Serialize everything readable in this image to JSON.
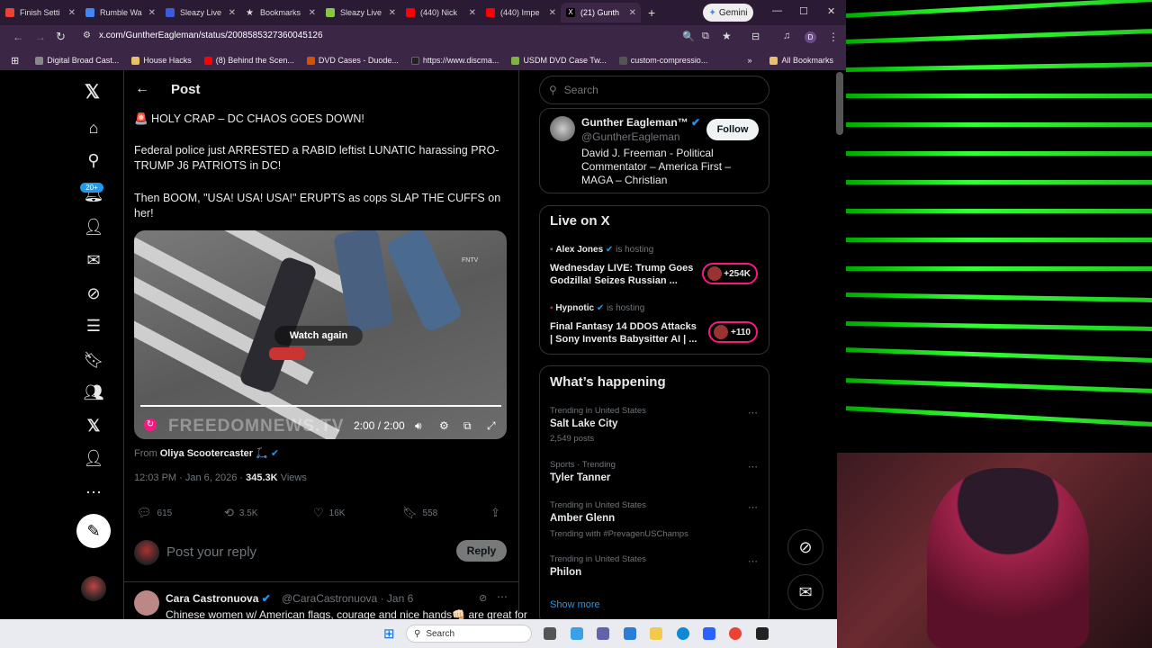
{
  "browser": {
    "tabs": [
      {
        "label": "Finish Setti",
        "color": "#ea4335"
      },
      {
        "label": "Rumble Wa",
        "color": "#4285f4"
      },
      {
        "label": "Sleazy Live",
        "color": "#3b5bdb"
      },
      {
        "label": "Bookmarks",
        "color": "#cccccc"
      },
      {
        "label": "Sleazy Live",
        "color": "#85c742"
      },
      {
        "label": "(440) Nick",
        "color": "#ff0000"
      },
      {
        "label": "(440) Impe",
        "color": "#ff0000"
      },
      {
        "label": "(21) Gunth",
        "color": "#ffffff"
      }
    ],
    "gemini_label": "Gemini",
    "url": "x.com/GuntherEagleman/status/2008585327360045126",
    "bookmarks": [
      {
        "label": "Digital Broad Cast...",
        "color": "#888888"
      },
      {
        "label": "House Hacks",
        "color": "#e8c06a"
      },
      {
        "label": "(8) Behind the Scen...",
        "color": "#ff0000"
      },
      {
        "label": "DVD Cases - Duode...",
        "color": "#d35400"
      },
      {
        "label": "https://www.discma...",
        "color": "#222222"
      },
      {
        "label": "USDM DVD Case Tw...",
        "color": "#7cb342"
      },
      {
        "label": "custom-compressio...",
        "color": "#555555"
      }
    ],
    "all_bookmarks": "All Bookmarks",
    "profile_initial": "D"
  },
  "nav": {
    "notif_badge": "20+"
  },
  "post": {
    "header": "Post",
    "line1": "🚨 HOLY CRAP – DC CHAOS GOES DOWN!",
    "line2": "Federal police just ARRESTED a RABID leftist LUNATIC harassing PRO-TRUMP J6 PATRIOTS in DC!",
    "line3": "Then BOOM,  \"USA! USA! USA!\" ERUPTS as cops SLAP THE CUFFS on her!",
    "video": {
      "watch_again": "Watch again",
      "watermark": "FREEDOMNEWS.TV",
      "corner_mark": "FNTV",
      "time": "2:00 / 2:00",
      "progress": 1.0
    },
    "from_prefix": "From",
    "from_name": "Oliya Scootercaster 🛴",
    "time": "12:03 PM · Jan 6, 2026 ·",
    "views": "345.3K",
    "views_label": "Views",
    "stats": {
      "replies": "615",
      "reposts": "3.5K",
      "likes": "16K",
      "bookmarks": "558"
    }
  },
  "reply": {
    "placeholder": "Post your reply",
    "button": "Reply"
  },
  "comment": {
    "name": "Cara Castronuova",
    "handle": "@CaraCastronuova · Jan 6",
    "text": "Chinese women w/ American flags, courage and nice hands👊🏻 are great for"
  },
  "sidebar": {
    "search_placeholder": "Search",
    "profile": {
      "name": "Gunther Eagleman™",
      "handle": "@GuntherEagleman",
      "bio": "David J. Freeman - Political Commentator – America First – MAGA – Christian",
      "follow": "Follow"
    },
    "live": {
      "heading": "Live on X",
      "items": [
        {
          "host": "Alex Jones",
          "status": "is hosting",
          "title": "Wednesday LIVE: Trump Goes Godzilla! Seizes Russian ...",
          "count": "+254K"
        },
        {
          "host": "Hypnotic",
          "status": "is hosting",
          "title": "Final Fantasy 14 DDOS Attacks | Sony Invents Babysitter AI | ...",
          "count": "+110"
        }
      ]
    },
    "trends": {
      "heading": "What’s happening",
      "items": [
        {
          "context": "Trending in United States",
          "name": "Salt Lake City",
          "extra": "2,549 posts"
        },
        {
          "context": "Sports · Trending",
          "name": "Tyler Tanner",
          "extra": ""
        },
        {
          "context": "Trending in United States",
          "name": "Amber Glenn",
          "extra": "Trending with #PrevagenUSChamps"
        },
        {
          "context": "Trending in United States",
          "name": "Philon",
          "extra": ""
        }
      ],
      "show_more": "Show more"
    }
  },
  "taskbar": {
    "search_placeholder": "Search"
  }
}
